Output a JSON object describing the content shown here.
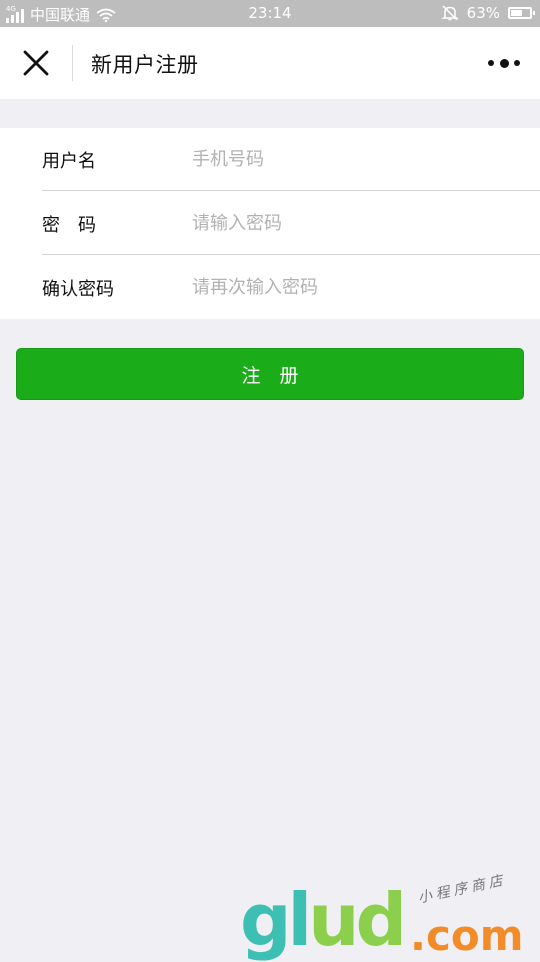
{
  "status_bar": {
    "network_badge": "4G",
    "carrier": "中国联通",
    "time": "23:14",
    "battery_percent": "63%",
    "battery_level": 0.63
  },
  "nav": {
    "title": "新用户注册"
  },
  "form": {
    "rows": [
      {
        "label": "用户名",
        "placeholder": "手机号码"
      },
      {
        "label": "密　码",
        "placeholder": "请输入密码"
      },
      {
        "label": "确认密码",
        "placeholder": "请再次输入密码"
      }
    ]
  },
  "submit": {
    "label": "注　册"
  },
  "watermark": {
    "logo_text": "glud",
    "domain_suffix": ".com",
    "slogan": "小程序商店"
  },
  "colors": {
    "primary_green": "#1aad19",
    "background": "#efeff4",
    "status_bar": "#bdbdbd",
    "placeholder": "#b2b2b2",
    "watermark_orange": "#f28c28",
    "watermark_teal": "#3dbfb3",
    "watermark_green": "#8ccf4d"
  },
  "icons": {
    "close": "close-icon",
    "more": "more-icon",
    "wifi": "wifi-icon",
    "signal": "signal-icon",
    "mute": "mute-bell-icon",
    "battery": "battery-icon"
  }
}
